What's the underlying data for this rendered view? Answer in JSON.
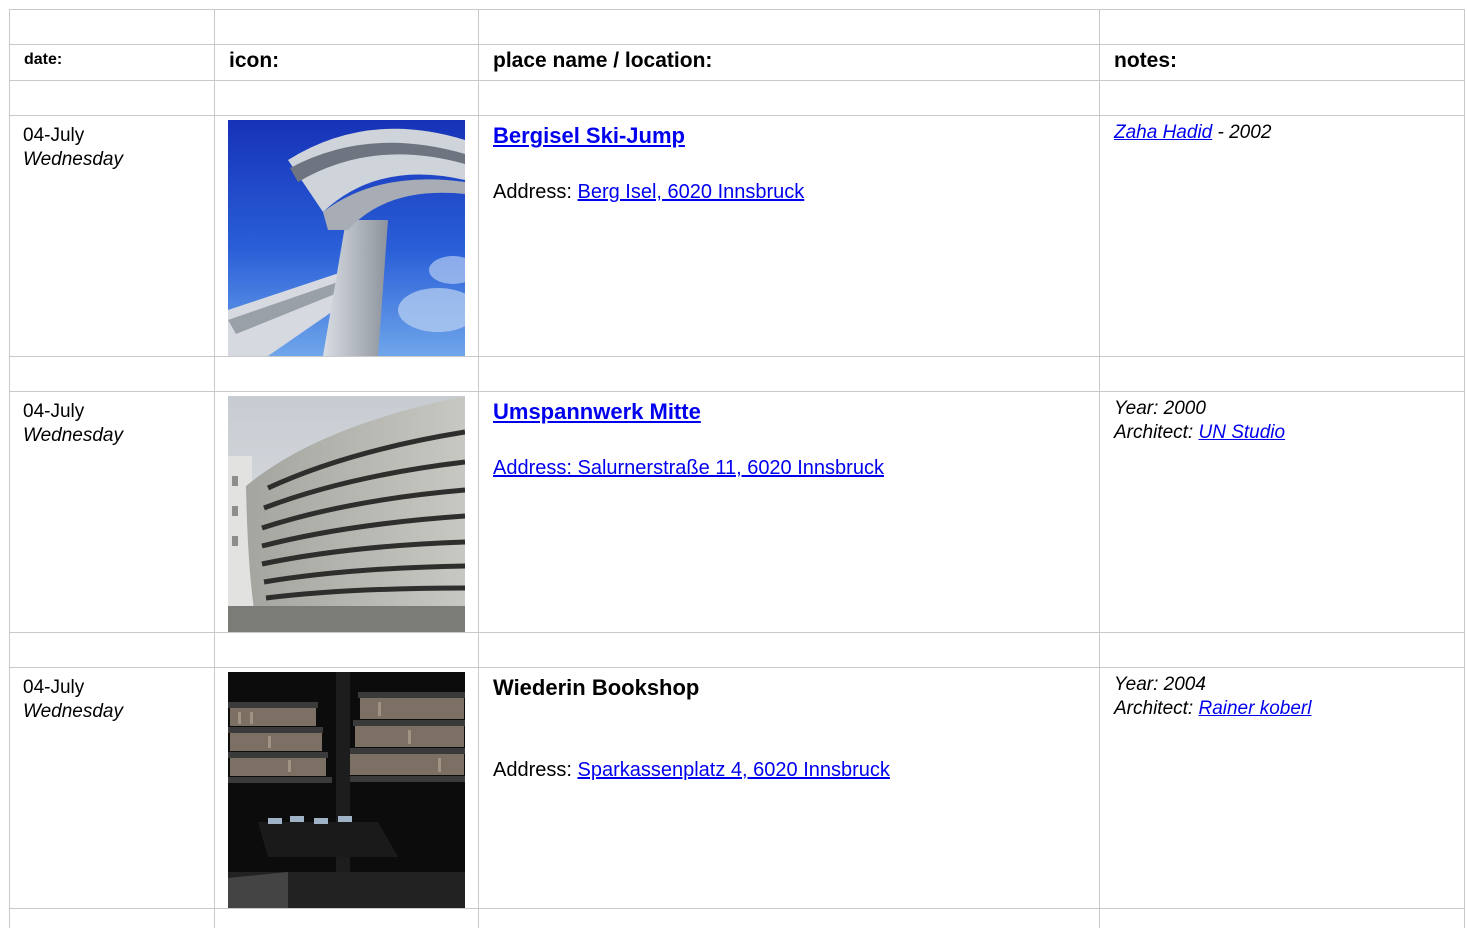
{
  "headers": {
    "date": "date:",
    "icon": "icon:",
    "place": "place name / location:",
    "notes": "notes:"
  },
  "rows": [
    {
      "date": "04-July",
      "weekday": "Wednesday",
      "icon": "bergisel-ski-jump-photo",
      "title": "Bergisel Ski-Jump",
      "address_label": "Address: ",
      "address_link": "Berg Isel, 6020 Innsbruck",
      "notes_link": "Zaha Hadid",
      "notes_text": " - 2002"
    },
    {
      "date": "04-July",
      "weekday": "Wednesday",
      "icon": "umspannwerk-mitte-photo",
      "title": "Umspannwerk Mitte",
      "address_full": "Address: Salurnerstraße 11, 6020 Innsbruck",
      "notes_year": "Year: 2000",
      "notes_arch_label": "Architect: ",
      "notes_arch_link": "UN Studio"
    },
    {
      "date": "04-July",
      "weekday": "Wednesday",
      "icon": "wiederin-bookshop-photo",
      "title": "Wiederin Bookshop",
      "address_label": "Address: ",
      "address_link": "Sparkassenplatz 4, 6020 Innsbruck",
      "notes_year": "Year: 2004",
      "notes_arch_label": "Architect: ",
      "notes_arch_link": "Rainer koberl"
    }
  ],
  "colors": {
    "link": "#0000ee",
    "border": "#c9c9c9"
  }
}
